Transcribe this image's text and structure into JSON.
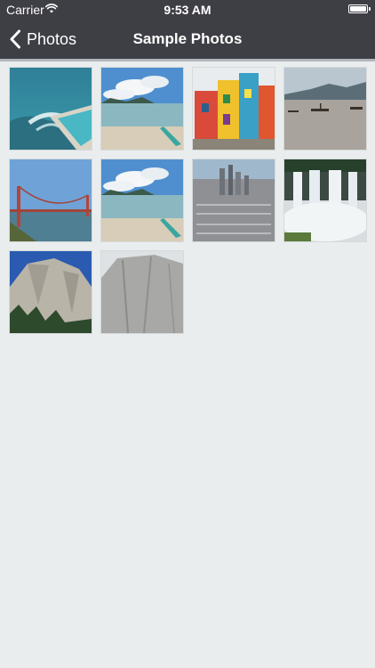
{
  "status_bar": {
    "carrier": "Carrier",
    "time": "9:53 AM"
  },
  "nav": {
    "back_label": "Photos",
    "title": "Sample Photos"
  },
  "icons": {
    "back": "chevron-left-icon",
    "wifi": "wifi-icon",
    "battery": "battery-icon"
  },
  "colors": {
    "nav_background": "#3e3e45",
    "content_background": "#e9eded",
    "nav_text": "#ffffff"
  },
  "photos": [
    {
      "subject": "ocean rock pool"
    },
    {
      "subject": "beach with kayak"
    },
    {
      "subject": "colorful houses"
    },
    {
      "subject": "boats on a lake"
    },
    {
      "subject": "golden gate bridge"
    },
    {
      "subject": "beach with kayak"
    },
    {
      "subject": "city skyline"
    },
    {
      "subject": "waterfall"
    },
    {
      "subject": "granite cliff"
    },
    {
      "subject": "granite rock face"
    }
  ]
}
